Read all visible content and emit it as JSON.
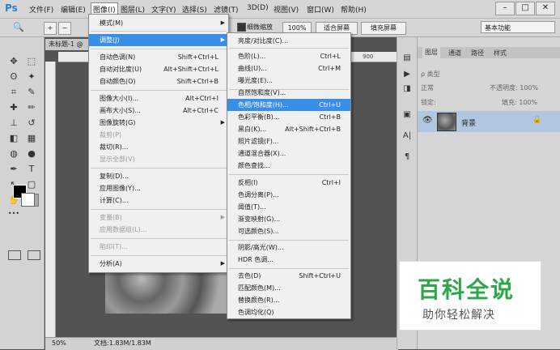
{
  "app": {
    "logo": "Ps"
  },
  "menubar": {
    "items": [
      "文件(F)",
      "编辑(E)",
      "图像(I)",
      "图层(L)",
      "文字(Y)",
      "选择(S)",
      "滤镜(T)",
      "3D(D)",
      "视图(V)",
      "窗口(W)",
      "帮助(H)"
    ],
    "active_index": 2
  },
  "window_controls": {
    "minimize": "–",
    "maximize": "□",
    "close": "✕"
  },
  "options_bar": {
    "scrubby_zoom": "细微缩放",
    "zoom_value": "100%",
    "fit_screen": "适合屏幕",
    "fill_screen": "填充屏幕",
    "workspace": "基本功能"
  },
  "document": {
    "tab_label": "未标题-1 @",
    "ruler_mark": "900",
    "status_zoom": "50%",
    "status_doc": "文档:1.83M/1.83M"
  },
  "image_menu": {
    "items": [
      {
        "label": "模式(M)",
        "shortcut": "",
        "submenu": true,
        "disabled": false
      },
      {
        "label": "调整(J)",
        "shortcut": "",
        "submenu": true,
        "disabled": false,
        "highlighted": true
      },
      {
        "label": "自动色调(N)",
        "shortcut": "Shift+Ctrl+L",
        "submenu": false,
        "disabled": false
      },
      {
        "label": "自动对比度(U)",
        "shortcut": "Alt+Shift+Ctrl+L",
        "submenu": false,
        "disabled": false
      },
      {
        "label": "自动颜色(O)",
        "shortcut": "Shift+Ctrl+B",
        "submenu": false,
        "disabled": false
      },
      {
        "label": "图像大小(I)...",
        "shortcut": "Alt+Ctrl+I",
        "submenu": false,
        "disabled": false
      },
      {
        "label": "画布大小(S)...",
        "shortcut": "Alt+Ctrl+C",
        "submenu": false,
        "disabled": false
      },
      {
        "label": "图像旋转(G)",
        "shortcut": "",
        "submenu": true,
        "disabled": false
      },
      {
        "label": "裁剪(P)",
        "shortcut": "",
        "submenu": false,
        "disabled": true
      },
      {
        "label": "裁切(R)...",
        "shortcut": "",
        "submenu": false,
        "disabled": false
      },
      {
        "label": "显示全部(V)",
        "shortcut": "",
        "submenu": false,
        "disabled": true
      },
      {
        "label": "复制(D)...",
        "shortcut": "",
        "submenu": false,
        "disabled": false
      },
      {
        "label": "应用图像(Y)...",
        "shortcut": "",
        "submenu": false,
        "disabled": false
      },
      {
        "label": "计算(C)...",
        "shortcut": "",
        "submenu": false,
        "disabled": false
      },
      {
        "label": "变量(B)",
        "shortcut": "",
        "submenu": true,
        "disabled": true
      },
      {
        "label": "应用数据组(L)...",
        "shortcut": "",
        "submenu": false,
        "disabled": true
      },
      {
        "label": "陷印(T)...",
        "shortcut": "",
        "submenu": false,
        "disabled": true
      },
      {
        "label": "分析(A)",
        "shortcut": "",
        "submenu": true,
        "disabled": false
      }
    ]
  },
  "adjust_menu": {
    "items": [
      {
        "label": "亮度/对比度(C)...",
        "shortcut": ""
      },
      {
        "label": "色阶(L)...",
        "shortcut": "Ctrl+L"
      },
      {
        "label": "曲线(U)...",
        "shortcut": "Ctrl+M"
      },
      {
        "label": "曝光度(E)...",
        "shortcut": ""
      },
      {
        "label": "自然饱和度(V)...",
        "shortcut": ""
      },
      {
        "label": "色相/饱和度(H)...",
        "shortcut": "Ctrl+U",
        "highlighted": true
      },
      {
        "label": "色彩平衡(B)...",
        "shortcut": "Ctrl+B"
      },
      {
        "label": "黑白(K)...",
        "shortcut": "Alt+Shift+Ctrl+B"
      },
      {
        "label": "照片滤镜(F)...",
        "shortcut": ""
      },
      {
        "label": "通道混合器(X)...",
        "shortcut": ""
      },
      {
        "label": "颜色查找...",
        "shortcut": ""
      },
      {
        "label": "反相(I)",
        "shortcut": "Ctrl+I"
      },
      {
        "label": "色调分离(P)...",
        "shortcut": ""
      },
      {
        "label": "阈值(T)...",
        "shortcut": ""
      },
      {
        "label": "渐变映射(G)...",
        "shortcut": ""
      },
      {
        "label": "可选颜色(S)...",
        "shortcut": ""
      },
      {
        "label": "阴影/高光(W)...",
        "shortcut": ""
      },
      {
        "label": "HDR 色调...",
        "shortcut": ""
      },
      {
        "label": "去色(D)",
        "shortcut": "Shift+Ctrl+U"
      },
      {
        "label": "匹配颜色(M)...",
        "shortcut": ""
      },
      {
        "label": "替换颜色(R)...",
        "shortcut": ""
      },
      {
        "label": "色调均化(Q)",
        "shortcut": ""
      }
    ]
  },
  "layers_panel": {
    "tabs": [
      "图层",
      "通道",
      "路径",
      "样式"
    ],
    "filter_kind": "ρ 类型",
    "blend_mode": "正常",
    "opacity_label": "不透明度: 100%",
    "lock_label": "锁定:",
    "fill_label": "填充: 100%",
    "layer_name": "背景"
  },
  "watermark": {
    "title": "百科全说",
    "subtitle": "助你轻松解决"
  },
  "icons": {
    "zoom": "🔍",
    "eye": "👁",
    "lock": "🔒",
    "move": "✥",
    "marquee": "⬚",
    "lasso": "ʘ",
    "magic": "✦",
    "crop": "⌗",
    "eyedropper": "✎",
    "heal": "✚",
    "brush": "✏",
    "stamp": "⊥",
    "history": "↺",
    "eraser": "◧",
    "gradient": "▦",
    "blur": "◍",
    "dodge": "●",
    "pen": "✒",
    "type": "T",
    "path": "↖",
    "shape": "▢",
    "hand": "✋",
    "zoomtool": "⌕",
    "more": "•••"
  }
}
